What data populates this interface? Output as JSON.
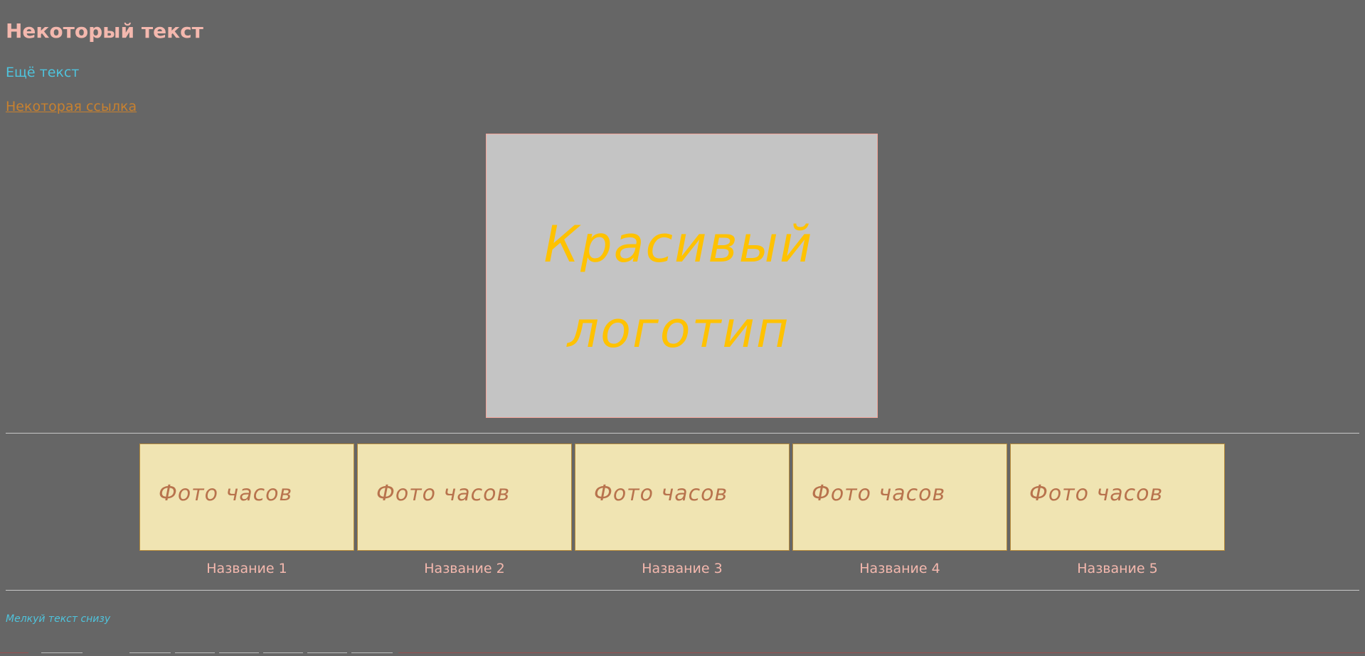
{
  "header": {
    "title": "Некоторый текст",
    "subtext": "Ещё текст",
    "link": "Некоторая ссылка"
  },
  "logo": {
    "text_line1": "Красивый",
    "text_line2": "логотип",
    "color": "#ffc200"
  },
  "gallery": {
    "items": [
      {
        "photo_text": "Фото часов",
        "caption": "Название 1"
      },
      {
        "photo_text": "Фото часов",
        "caption": "Название 2"
      },
      {
        "photo_text": "Фото часов",
        "caption": "Название 3"
      },
      {
        "photo_text": "Фото часов",
        "caption": "Название 4"
      },
      {
        "photo_text": "Фото часов",
        "caption": "Название 5"
      }
    ]
  },
  "footer": {
    "small_text": "Мелкуй текст снизу"
  },
  "colors": {
    "background": "#666666",
    "title": "#f4b8ae",
    "accent_text": "#4fc3dc",
    "link": "#c8812f",
    "photo_bg": "#f0e4b2",
    "photo_text": "#b8734d",
    "logo_bg": "#c4c4c4"
  }
}
